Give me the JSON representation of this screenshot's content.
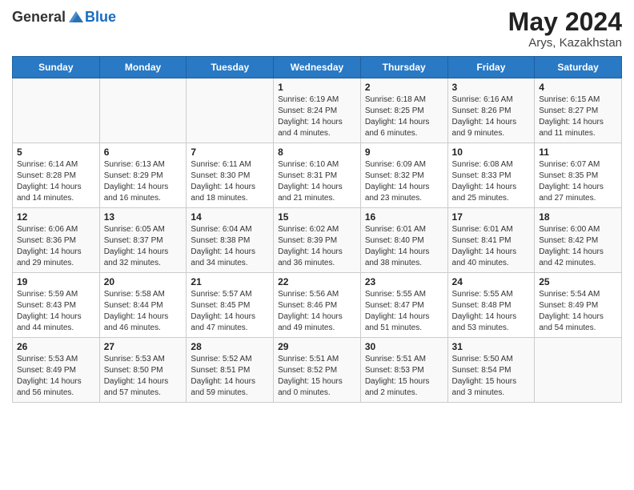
{
  "header": {
    "logo_general": "General",
    "logo_blue": "Blue",
    "title": "May 2024",
    "subtitle": "Arys, Kazakhstan"
  },
  "days_of_week": [
    "Sunday",
    "Monday",
    "Tuesday",
    "Wednesday",
    "Thursday",
    "Friday",
    "Saturday"
  ],
  "weeks": [
    [
      {
        "day": "",
        "info": ""
      },
      {
        "day": "",
        "info": ""
      },
      {
        "day": "",
        "info": ""
      },
      {
        "day": "1",
        "info": "Sunrise: 6:19 AM\nSunset: 8:24 PM\nDaylight: 14 hours\nand 4 minutes."
      },
      {
        "day": "2",
        "info": "Sunrise: 6:18 AM\nSunset: 8:25 PM\nDaylight: 14 hours\nand 6 minutes."
      },
      {
        "day": "3",
        "info": "Sunrise: 6:16 AM\nSunset: 8:26 PM\nDaylight: 14 hours\nand 9 minutes."
      },
      {
        "day": "4",
        "info": "Sunrise: 6:15 AM\nSunset: 8:27 PM\nDaylight: 14 hours\nand 11 minutes."
      }
    ],
    [
      {
        "day": "5",
        "info": "Sunrise: 6:14 AM\nSunset: 8:28 PM\nDaylight: 14 hours\nand 14 minutes."
      },
      {
        "day": "6",
        "info": "Sunrise: 6:13 AM\nSunset: 8:29 PM\nDaylight: 14 hours\nand 16 minutes."
      },
      {
        "day": "7",
        "info": "Sunrise: 6:11 AM\nSunset: 8:30 PM\nDaylight: 14 hours\nand 18 minutes."
      },
      {
        "day": "8",
        "info": "Sunrise: 6:10 AM\nSunset: 8:31 PM\nDaylight: 14 hours\nand 21 minutes."
      },
      {
        "day": "9",
        "info": "Sunrise: 6:09 AM\nSunset: 8:32 PM\nDaylight: 14 hours\nand 23 minutes."
      },
      {
        "day": "10",
        "info": "Sunrise: 6:08 AM\nSunset: 8:33 PM\nDaylight: 14 hours\nand 25 minutes."
      },
      {
        "day": "11",
        "info": "Sunrise: 6:07 AM\nSunset: 8:35 PM\nDaylight: 14 hours\nand 27 minutes."
      }
    ],
    [
      {
        "day": "12",
        "info": "Sunrise: 6:06 AM\nSunset: 8:36 PM\nDaylight: 14 hours\nand 29 minutes."
      },
      {
        "day": "13",
        "info": "Sunrise: 6:05 AM\nSunset: 8:37 PM\nDaylight: 14 hours\nand 32 minutes."
      },
      {
        "day": "14",
        "info": "Sunrise: 6:04 AM\nSunset: 8:38 PM\nDaylight: 14 hours\nand 34 minutes."
      },
      {
        "day": "15",
        "info": "Sunrise: 6:02 AM\nSunset: 8:39 PM\nDaylight: 14 hours\nand 36 minutes."
      },
      {
        "day": "16",
        "info": "Sunrise: 6:01 AM\nSunset: 8:40 PM\nDaylight: 14 hours\nand 38 minutes."
      },
      {
        "day": "17",
        "info": "Sunrise: 6:01 AM\nSunset: 8:41 PM\nDaylight: 14 hours\nand 40 minutes."
      },
      {
        "day": "18",
        "info": "Sunrise: 6:00 AM\nSunset: 8:42 PM\nDaylight: 14 hours\nand 42 minutes."
      }
    ],
    [
      {
        "day": "19",
        "info": "Sunrise: 5:59 AM\nSunset: 8:43 PM\nDaylight: 14 hours\nand 44 minutes."
      },
      {
        "day": "20",
        "info": "Sunrise: 5:58 AM\nSunset: 8:44 PM\nDaylight: 14 hours\nand 46 minutes."
      },
      {
        "day": "21",
        "info": "Sunrise: 5:57 AM\nSunset: 8:45 PM\nDaylight: 14 hours\nand 47 minutes."
      },
      {
        "day": "22",
        "info": "Sunrise: 5:56 AM\nSunset: 8:46 PM\nDaylight: 14 hours\nand 49 minutes."
      },
      {
        "day": "23",
        "info": "Sunrise: 5:55 AM\nSunset: 8:47 PM\nDaylight: 14 hours\nand 51 minutes."
      },
      {
        "day": "24",
        "info": "Sunrise: 5:55 AM\nSunset: 8:48 PM\nDaylight: 14 hours\nand 53 minutes."
      },
      {
        "day": "25",
        "info": "Sunrise: 5:54 AM\nSunset: 8:49 PM\nDaylight: 14 hours\nand 54 minutes."
      }
    ],
    [
      {
        "day": "26",
        "info": "Sunrise: 5:53 AM\nSunset: 8:49 PM\nDaylight: 14 hours\nand 56 minutes."
      },
      {
        "day": "27",
        "info": "Sunrise: 5:53 AM\nSunset: 8:50 PM\nDaylight: 14 hours\nand 57 minutes."
      },
      {
        "day": "28",
        "info": "Sunrise: 5:52 AM\nSunset: 8:51 PM\nDaylight: 14 hours\nand 59 minutes."
      },
      {
        "day": "29",
        "info": "Sunrise: 5:51 AM\nSunset: 8:52 PM\nDaylight: 15 hours\nand 0 minutes."
      },
      {
        "day": "30",
        "info": "Sunrise: 5:51 AM\nSunset: 8:53 PM\nDaylight: 15 hours\nand 2 minutes."
      },
      {
        "day": "31",
        "info": "Sunrise: 5:50 AM\nSunset: 8:54 PM\nDaylight: 15 hours\nand 3 minutes."
      },
      {
        "day": "",
        "info": ""
      }
    ]
  ]
}
